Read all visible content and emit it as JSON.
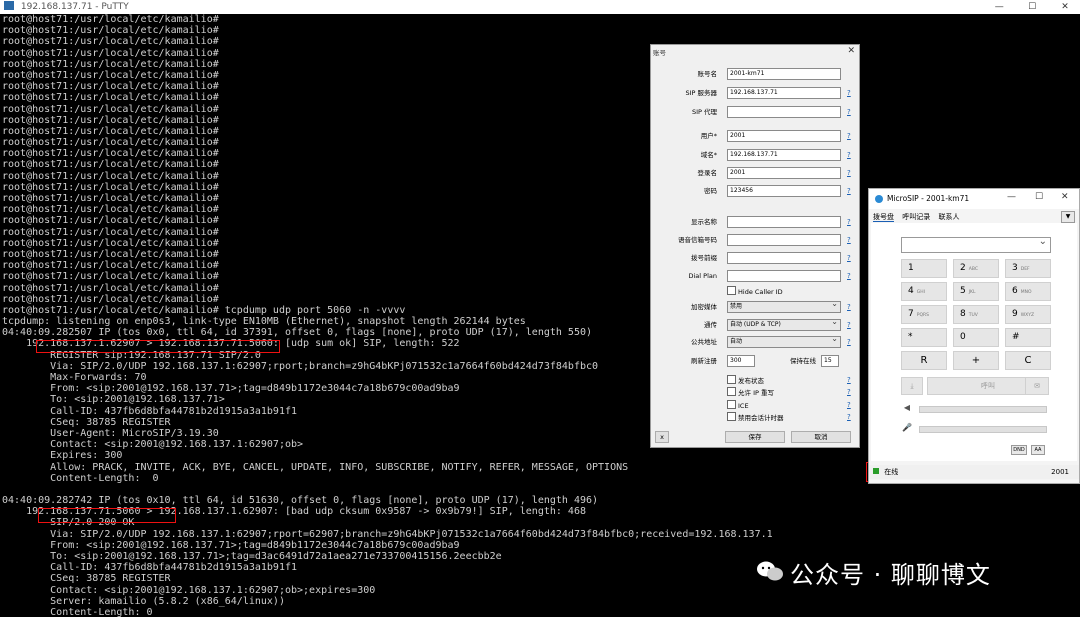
{
  "putty": {
    "title": "192.168.137.71 - PuTTY",
    "controls": [
      "—",
      "☐",
      "✕"
    ],
    "lines": [
      "root@host71:/usr/local/etc/kamailio#",
      "root@host71:/usr/local/etc/kamailio#",
      "root@host71:/usr/local/etc/kamailio#",
      "root@host71:/usr/local/etc/kamailio#",
      "root@host71:/usr/local/etc/kamailio#",
      "root@host71:/usr/local/etc/kamailio#",
      "root@host71:/usr/local/etc/kamailio#",
      "root@host71:/usr/local/etc/kamailio#",
      "root@host71:/usr/local/etc/kamailio#",
      "root@host71:/usr/local/etc/kamailio#",
      "root@host71:/usr/local/etc/kamailio#",
      "root@host71:/usr/local/etc/kamailio#",
      "root@host71:/usr/local/etc/kamailio#",
      "root@host71:/usr/local/etc/kamailio#",
      "root@host71:/usr/local/etc/kamailio#",
      "root@host71:/usr/local/etc/kamailio#",
      "root@host71:/usr/local/etc/kamailio#",
      "root@host71:/usr/local/etc/kamailio#",
      "root@host71:/usr/local/etc/kamailio#",
      "root@host71:/usr/local/etc/kamailio#",
      "root@host71:/usr/local/etc/kamailio#",
      "root@host71:/usr/local/etc/kamailio#",
      "root@host71:/usr/local/etc/kamailio#",
      "root@host71:/usr/local/etc/kamailio#",
      "root@host71:/usr/local/etc/kamailio#",
      "root@host71:/usr/local/etc/kamailio#",
      "root@host71:/usr/local/etc/kamailio# tcpdump udp port 5060 -n -vvvv",
      "tcpdump: listening on enp0s3, link-type EN10MB (Ethernet), snapshot length 262144 bytes",
      "04:40:09.282507 IP (tos 0x0, ttl 64, id 37391, offset 0, flags [none], proto UDP (17), length 550)",
      "    192.168.137.1.62907 > 192.168.137.71.5060: [udp sum ok] SIP, length: 522",
      "        REGISTER sip:192.168.137.71 SIP/2.0",
      "        Via: SIP/2.0/UDP 192.168.137.1:62907;rport;branch=z9hG4bKPj071532c1a7664f60bd424d73f84bfbc0",
      "        Max-Forwards: 70",
      "        From: <sip:2001@192.168.137.71>;tag=d849b1172e3044c7a18b679c00ad9ba9",
      "        To: <sip:2001@192.168.137.71>",
      "        Call-ID: 437fb6d8bfa44781b2d1915a3a1b91f1",
      "        CSeq: 38785 REGISTER",
      "        User-Agent: MicroSIP/3.19.30",
      "        Contact: <sip:2001@192.168.137.1:62907;ob>",
      "        Expires: 300",
      "        Allow: PRACK, INVITE, ACK, BYE, CANCEL, UPDATE, INFO, SUBSCRIBE, NOTIFY, REFER, MESSAGE, OPTIONS",
      "        Content-Length:  0",
      "",
      "04:40:09.282742 IP (tos 0x10, ttl 64, id 51630, offset 0, flags [none], proto UDP (17), length 496)",
      "    192.168.137.71.5060 > 192.168.137.1.62907: [bad udp cksum 0x9587 -> 0x9b79!] SIP, length: 468",
      "        SIP/2.0 200 OK",
      "        Via: SIP/2.0/UDP 192.168.137.1:62907;rport=62907;branch=z9hG4bKPj071532c1a7664f60bd424d73f84bfbc0;received=192.168.137.1",
      "        From: <sip:2001@192.168.137.71>;tag=d849b1172e3044c7a18b679c00ad9ba9",
      "        To: <sip:2001@192.168.137.71>;tag=d3ac6491d72a1aea271e733700415156.2eecbb2e",
      "        Call-ID: 437fb6d8bfa44781b2d1915a3a1b91f1",
      "        CSeq: 38785 REGISTER",
      "        Contact: <sip:2001@192.168.137.1:62907;ob>;expires=300",
      "        Server: kamailio (5.8.2 (x86_64/linux))",
      "        Content-Length: 0"
    ]
  },
  "account": {
    "title": "账号",
    "close": "✕",
    "fields": [
      {
        "label": "账号名",
        "value": "2001-km71",
        "help": ""
      },
      {
        "label": "SIP 服务器",
        "value": "192.168.137.71",
        "help": "?"
      },
      {
        "label": "SIP 代理",
        "value": "",
        "help": "?"
      },
      {
        "label": "用户*",
        "value": "2001",
        "help": "?"
      },
      {
        "label": "域名*",
        "value": "192.168.137.71",
        "help": "?"
      },
      {
        "label": "登录名",
        "value": "2001",
        "help": "?"
      },
      {
        "label": "密码",
        "value": "123456",
        "help": "?"
      },
      {
        "label": "显示名称",
        "value": "",
        "help": "?"
      },
      {
        "label": "语音信箱号码",
        "value": "",
        "help": "?"
      },
      {
        "label": "拨号前缀",
        "value": "",
        "help": "?"
      },
      {
        "label": "Dial Plan",
        "value": "",
        "help": "?"
      }
    ],
    "hide_caller_id": "Hide Caller ID",
    "selects": [
      {
        "label": "加密媒体",
        "value": "禁用",
        "help": "?"
      },
      {
        "label": "通传",
        "value": "自动 (UDP & TCP)",
        "help": "?"
      },
      {
        "label": "公共地址",
        "value": "自动",
        "help": "?"
      }
    ],
    "refresh_label": "刷新注册",
    "refresh_value": "300",
    "keepalive_label": "保持在线",
    "keepalive_value": "15",
    "checks": [
      {
        "label": "发布状态",
        "help": "?"
      },
      {
        "label": "允许 IP 重写",
        "help": "?"
      },
      {
        "label": "ICE",
        "help": "?"
      },
      {
        "label": "禁用会话计时器",
        "help": "?"
      }
    ],
    "x_button": "x",
    "save": "保存",
    "cancel": "取消"
  },
  "microsip": {
    "title": "MicroSIP - 2001-km71",
    "controls": [
      "—",
      "☐",
      "✕"
    ],
    "tabs": [
      "拨号盘",
      "呼叫记录",
      "联系人"
    ],
    "menu": "▼",
    "keys": [
      {
        "d": "1",
        "s": ""
      },
      {
        "d": "2",
        "s": "ABC"
      },
      {
        "d": "3",
        "s": "DEF"
      },
      {
        "d": "4",
        "s": "GHI"
      },
      {
        "d": "5",
        "s": "JKL"
      },
      {
        "d": "6",
        "s": "MNO"
      },
      {
        "d": "7",
        "s": "PQRS"
      },
      {
        "d": "8",
        "s": "TUV"
      },
      {
        "d": "9",
        "s": "WXYZ"
      },
      {
        "d": "*",
        "s": ""
      },
      {
        "d": "0",
        "s": ""
      },
      {
        "d": "#",
        "s": ""
      }
    ],
    "ops": [
      "R",
      "+",
      "C"
    ],
    "call": "呼叫",
    "dnd": "DND",
    "aa": "AA",
    "status": "在线",
    "status_number": "2001",
    "colors": {
      "status": "#2a9d2a",
      "highlight": "#e11111"
    }
  },
  "watermark": "公众号 · 聊聊博文"
}
